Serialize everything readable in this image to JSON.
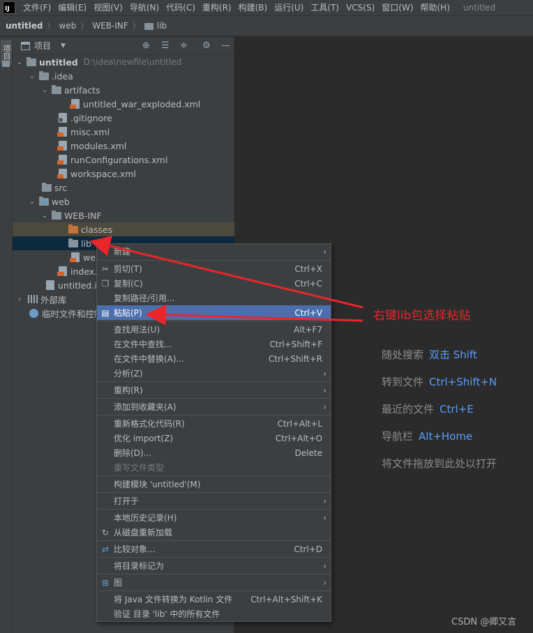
{
  "menubar": {
    "logo": "IJ",
    "items": [
      "文件(F)",
      "编辑(E)",
      "视图(V)",
      "导航(N)",
      "代码(C)",
      "重构(R)",
      "构建(B)",
      "运行(U)",
      "工具(T)",
      "VCS(S)",
      "窗口(W)",
      "帮助(H)"
    ],
    "window_title": "untitled"
  },
  "breadcrumb": [
    "untitled",
    "web",
    "WEB-INF",
    "lib"
  ],
  "tool_strip": {
    "tab_label": "项目"
  },
  "project_panel": {
    "title": "项目",
    "tree": [
      {
        "label": "untitled",
        "path": "D:\\idea\\newfile\\untitled"
      },
      {
        "label": ".idea"
      },
      {
        "label": "artifacts"
      },
      {
        "label": "untitled_war_exploded.xml"
      },
      {
        "label": ".gitignore"
      },
      {
        "label": "misc.xml"
      },
      {
        "label": "modules.xml"
      },
      {
        "label": "runConfigurations.xml"
      },
      {
        "label": "workspace.xml"
      },
      {
        "label": "src"
      },
      {
        "label": "web"
      },
      {
        "label": "WEB-INF"
      },
      {
        "label": "classes"
      },
      {
        "label": "lib"
      },
      {
        "label": "web"
      },
      {
        "label": "index.js"
      },
      {
        "label": "untitled.im"
      },
      {
        "label": "外部库"
      },
      {
        "label": "临时文件和控制"
      }
    ]
  },
  "context_menu": {
    "items": [
      {
        "label": "新建",
        "shortcut": ""
      },
      {
        "label": "剪切(T)",
        "shortcut": "Ctrl+X"
      },
      {
        "label": "复制(C)",
        "shortcut": "Ctrl+C"
      },
      {
        "label": "复制路径/引用...",
        "shortcut": ""
      },
      {
        "label": "粘贴(P)",
        "shortcut": "Ctrl+V"
      },
      {
        "label": "查找用法(U)",
        "shortcut": "Alt+F7"
      },
      {
        "label": "在文件中查找...",
        "shortcut": "Ctrl+Shift+F"
      },
      {
        "label": "在文件中替换(A)...",
        "shortcut": "Ctrl+Shift+R"
      },
      {
        "label": "分析(Z)",
        "shortcut": ""
      },
      {
        "label": "重构(R)",
        "shortcut": ""
      },
      {
        "label": "添加到收藏夹(A)",
        "shortcut": ""
      },
      {
        "label": "重新格式化代码(R)",
        "shortcut": "Ctrl+Alt+L"
      },
      {
        "label": "优化 import(Z)",
        "shortcut": "Ctrl+Alt+O"
      },
      {
        "label": "删除(D)...",
        "shortcut": "Delete"
      },
      {
        "label": "重写文件类型",
        "shortcut": ""
      },
      {
        "label": "构建模块 'untitled'(M)",
        "shortcut": ""
      },
      {
        "label": "打开于",
        "shortcut": ""
      },
      {
        "label": "本地历史记录(H)",
        "shortcut": ""
      },
      {
        "label": "从磁盘重新加载",
        "shortcut": ""
      },
      {
        "label": "比较对象...",
        "shortcut": "Ctrl+D"
      },
      {
        "label": "将目录标记为",
        "shortcut": ""
      },
      {
        "label": "图",
        "shortcut": ""
      },
      {
        "label": "将 Java 文件转换为 Kotlin 文件",
        "shortcut": "Ctrl+Alt+Shift+K"
      },
      {
        "label": "验证 目录 'lib' 中的所有文件",
        "shortcut": ""
      }
    ]
  },
  "editor_hints": [
    {
      "text": "随处搜索",
      "key": "双击 Shift"
    },
    {
      "text": "转到文件",
      "key": "Ctrl+Shift+N"
    },
    {
      "text": "最近的文件",
      "key": "Ctrl+E"
    },
    {
      "text": "导航栏",
      "key": "Alt+Home"
    },
    {
      "text": "将文件拖放到此处以打开",
      "key": ""
    }
  ],
  "annotation": "右键lib包选择粘贴",
  "watermark": "CSDN @卿又言",
  "colors": {
    "accent_selected": "#4b6eaf",
    "annotation_red": "#e8262b",
    "hint_key_blue": "#589df6"
  }
}
